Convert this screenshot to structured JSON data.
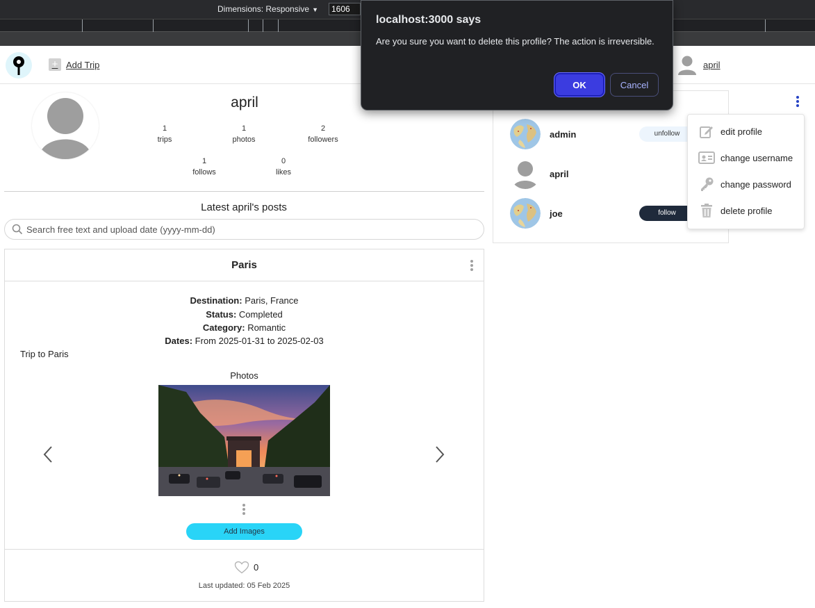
{
  "devtools": {
    "dimensions_label": "Dimensions: Responsive",
    "width_value": "1606"
  },
  "header": {
    "logo_icon": "map-pin-icon",
    "add_trip_label": "Add Trip",
    "username": "april"
  },
  "profile": {
    "name": "april",
    "stats": [
      {
        "value": "1",
        "label": "trips"
      },
      {
        "value": "1",
        "label": "photos"
      },
      {
        "value": "2",
        "label": "followers"
      },
      {
        "value": "1",
        "label": "follows"
      },
      {
        "value": "0",
        "label": "likes"
      }
    ]
  },
  "posts": {
    "heading": "Latest april's posts",
    "search_placeholder": "Search free text and upload date (yyyy-mm-dd)"
  },
  "trip": {
    "title": "Paris",
    "destination_label": "Destination:",
    "destination": "Paris, France",
    "status_label": "Status:",
    "status": "Completed",
    "category_label": "Category:",
    "category": "Romantic",
    "dates_label": "Dates:",
    "dates": "From 2025-01-31 to 2025-02-03",
    "description": "Trip to Paris",
    "photos_label": "Photos",
    "add_images_label": "Add Images",
    "likes": "0",
    "last_updated": "Last updated: 05 Feb 2025"
  },
  "followers": [
    {
      "name": "admin",
      "button": "unfollow",
      "avatar": "globe-avatar"
    },
    {
      "name": "april",
      "button": "",
      "avatar": "default-avatar"
    },
    {
      "name": "joe",
      "button": "follow",
      "avatar": "globe-avatar"
    }
  ],
  "profile_menu": {
    "items": [
      {
        "label": "edit profile",
        "icon": "edit-icon"
      },
      {
        "label": "change username",
        "icon": "id-card-icon"
      },
      {
        "label": "change password",
        "icon": "key-icon"
      },
      {
        "label": "delete profile",
        "icon": "trash-icon"
      }
    ]
  },
  "dialog": {
    "title": "localhost:3000 says",
    "message": "Are you sure you want to delete this profile? The action is irreversible.",
    "ok_label": "OK",
    "cancel_label": "Cancel"
  },
  "colors": {
    "dialog_bg": "#202124",
    "ok_button": "#3b3ce0",
    "add_images_button": "#29d4f7",
    "follow_button": "#1f2a3b",
    "kebab_accent": "#2542c4"
  }
}
